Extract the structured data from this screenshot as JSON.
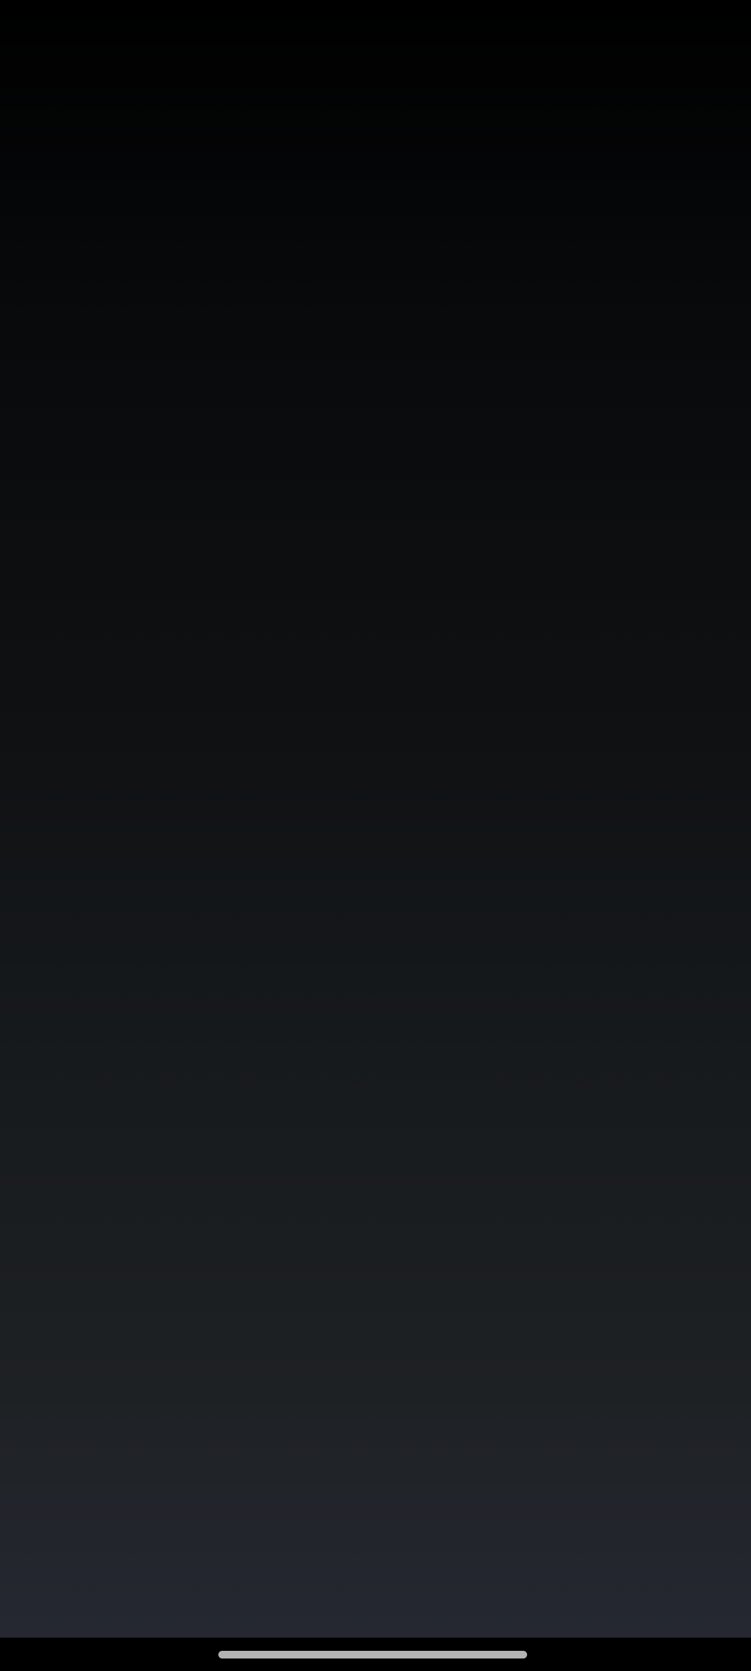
{
  "colors": {
    "gradient_top": "#000000",
    "gradient_bottom": "#252831",
    "navigation_bar": "#000000",
    "gesture_handle": "#b3b3b3"
  },
  "icons": {
    "gesture_handle": "gesture-navigation-handle"
  }
}
